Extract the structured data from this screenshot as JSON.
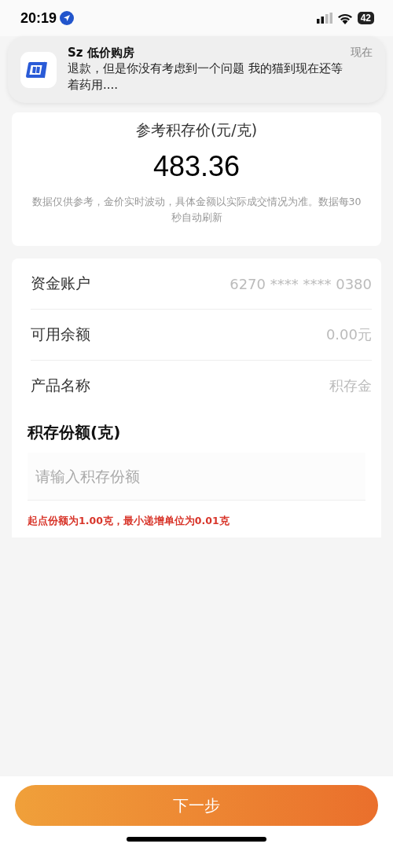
{
  "status_bar": {
    "time": "20:19",
    "battery": "42"
  },
  "notification": {
    "app": "Sz 低价购房",
    "time": "现在",
    "message": "退款，但是你没有考虑到一个问题  我的猫到现在还等着药用...."
  },
  "price_card": {
    "title": "参考积存价(元/克)",
    "price": "483.36",
    "note": "数据仅供参考，金价实时波动，具体金额以实际成交情况为准。数据每30秒自动刷新"
  },
  "info_rows": [
    {
      "label": "资金账户",
      "value": "6270 **** **** 0380"
    },
    {
      "label": "可用余额",
      "value": "0.00元"
    },
    {
      "label": "产品名称",
      "value": "积存金"
    }
  ],
  "amount": {
    "title": "积存份额(克)",
    "placeholder": "请输入积存份额",
    "hint": "起点份额为1.00克，最小递增单位为0.01克"
  },
  "next_button": "下一步"
}
